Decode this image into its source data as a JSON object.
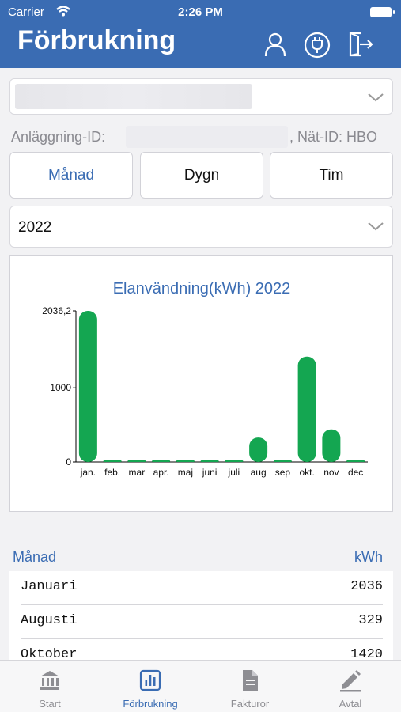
{
  "status": {
    "carrier": "Carrier",
    "time": "2:26 PM"
  },
  "header": {
    "title": "Förbrukning",
    "icons": [
      "user-icon",
      "power-plug-icon",
      "logout-door-icon"
    ]
  },
  "facility_dropdown": {
    "value": "",
    "icon": "chevron-down-icon"
  },
  "ids": {
    "facility_label": "Anläggning-ID:",
    "net_label": ", Nät-ID: HBO"
  },
  "segments": [
    {
      "label": "Månad",
      "active": true
    },
    {
      "label": "Dygn",
      "active": false
    },
    {
      "label": "Tim",
      "active": false
    }
  ],
  "year_dropdown": {
    "value": "2022"
  },
  "colors": {
    "accent": "#3a6cb3",
    "bar": "#14a651"
  },
  "chart_data": {
    "type": "bar",
    "title": "Elanvändning(kWh) 2022",
    "categories": [
      "jan.",
      "feb.",
      "mar",
      "apr.",
      "maj",
      "juni",
      "juli",
      "aug",
      "sep",
      "okt.",
      "nov",
      "dec"
    ],
    "values": [
      2036.2,
      0,
      0,
      0,
      0,
      0,
      0,
      329,
      0,
      1420,
      440,
      0
    ],
    "yticks": [
      "0",
      "1000",
      "2036,2"
    ],
    "ylim": [
      0,
      2036.2
    ]
  },
  "list": {
    "header_left": "Månad",
    "header_right": "kWh",
    "rows": [
      {
        "month": "Januari",
        "kwh": "2036"
      },
      {
        "month": "Augusti",
        "kwh": "329"
      },
      {
        "month": "Oktober",
        "kwh": "1420"
      }
    ]
  },
  "tabs": [
    {
      "label": "Start",
      "icon": "bank-icon",
      "active": false
    },
    {
      "label": "Förbrukning",
      "icon": "bar-chart-icon",
      "active": true
    },
    {
      "label": "Fakturor",
      "icon": "document-icon",
      "active": false
    },
    {
      "label": "Avtal",
      "icon": "pen-icon",
      "active": false
    }
  ]
}
